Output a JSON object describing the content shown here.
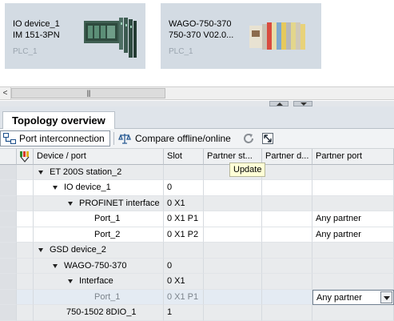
{
  "network_view": {
    "devices": [
      {
        "name": "IO device_1",
        "type": "IM 151-3PN",
        "plc": "PLC_1"
      },
      {
        "name": "WAGO-750-370",
        "type": "750-370 V02.0...",
        "plc": "PLC_1"
      }
    ]
  },
  "scrollbar": {
    "left_arrow": "<",
    "thumb_grip": "|||"
  },
  "tab": {
    "title": "Topology overview"
  },
  "toolbar": {
    "port_interconnection": "Port interconnection",
    "compare": "Compare offline/online"
  },
  "table": {
    "headers": {
      "device_port": "Device / port",
      "slot": "Slot",
      "partner_station": "Partner st...",
      "partner_device": "Partner d...",
      "partner_port": "Partner port"
    },
    "rows": [
      {
        "name": "ET 200S station_2",
        "slot": "",
        "partner_port": ""
      },
      {
        "name": "IO device_1",
        "slot": "0",
        "partner_port": ""
      },
      {
        "name": "PROFINET interface",
        "slot": "0 X1",
        "partner_port": ""
      },
      {
        "name": "Port_1",
        "slot": "0 X1 P1",
        "partner_port": "Any partner"
      },
      {
        "name": "Port_2",
        "slot": "0 X1 P2",
        "partner_port": "Any partner"
      },
      {
        "name": "GSD device_2",
        "slot": "",
        "partner_port": ""
      },
      {
        "name": "WAGO-750-370",
        "slot": "0",
        "partner_port": ""
      },
      {
        "name": "Interface",
        "slot": "0 X1",
        "partner_port": ""
      },
      {
        "name": "Port_1",
        "slot": "0 X1 P1",
        "partner_port": "Any partner"
      },
      {
        "name": "750-1502 8DIO_1",
        "slot": "1",
        "partner_port": ""
      }
    ]
  },
  "tooltip": {
    "text": "Update"
  },
  "colors": {
    "card_bg": "#d3dbe3",
    "selection_row": "#e4ebf3",
    "tooltip_bg": "#ffffd6"
  }
}
